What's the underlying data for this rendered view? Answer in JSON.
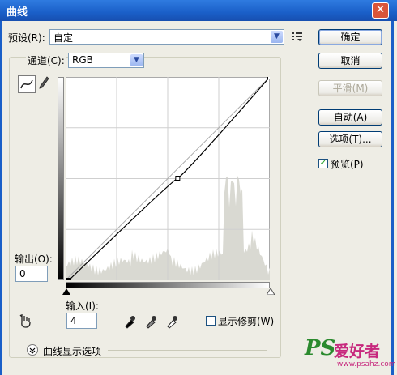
{
  "window": {
    "title": "曲线",
    "close_glyph": "✕"
  },
  "preset": {
    "label": "预设(R):",
    "value": "自定"
  },
  "channel": {
    "label": "通道(C):",
    "value": "RGB"
  },
  "buttons": {
    "ok": "确定",
    "cancel": "取消",
    "smooth": "平滑(M)",
    "auto": "自动(A)",
    "options": "选项(T)..."
  },
  "preview": {
    "label": "预览(P)",
    "checked": true
  },
  "output": {
    "label": "输出(O):",
    "value": "0"
  },
  "input": {
    "label": "输入(I):",
    "value": "4"
  },
  "show_clipping": {
    "label": "显示修剪(W)",
    "checked": false
  },
  "curve_options": {
    "label": "曲线显示选项"
  },
  "icons": {
    "preset_menu": "menu-icon",
    "curve_tool": "curve-tool-icon",
    "pencil_tool": "pencil-icon",
    "hand_tool": "hand-icon",
    "eyedroppers": [
      "black-eyedropper-icon",
      "gray-eyedropper-icon",
      "white-eyedropper-icon"
    ],
    "expand": "chevron-down-icon"
  },
  "curve": {
    "points": [
      [
        4,
        0
      ],
      [
        140,
        128
      ],
      [
        255,
        255
      ]
    ],
    "histogram_color": "#d9d9d2",
    "grid_divisions": 4
  },
  "watermark": {
    "ps": "PS",
    "cn": "爱好者",
    "url": "www.psahz.com"
  }
}
